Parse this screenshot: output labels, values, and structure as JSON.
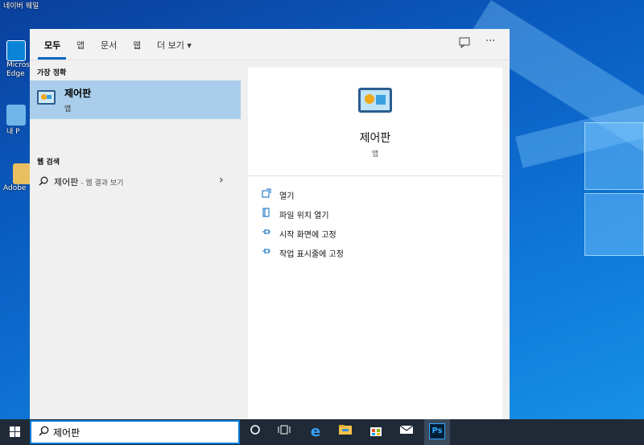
{
  "desktop": {
    "icons": [
      {
        "label": "네이버 웨일"
      },
      {
        "label": "Microsoft Edge",
        "short": "Micros Edge"
      },
      {
        "label": "내 PC",
        "short": "내 P"
      },
      {
        "label": "Adobe",
        "short": "Adobe"
      }
    ]
  },
  "start_menu": {
    "tabs": [
      "모두",
      "앱",
      "문서",
      "웹",
      "더 보기"
    ],
    "more_chevron": "▾",
    "feedback_icon": "feedback-icon",
    "options_label": "···",
    "best_match_header": "가장 정확",
    "best_match": {
      "title": "제어판",
      "subtitle": "앱"
    },
    "web_search_header": "웹 검색",
    "web_result": {
      "query": "제어판",
      "suffix": " - 웹 결과 보기"
    },
    "detail": {
      "title": "제어판",
      "subtitle": "앱",
      "actions": [
        "열기",
        "파일 위치 열기",
        "시작 화면에 고정",
        "작업 표시줄에 고정"
      ]
    }
  },
  "taskbar": {
    "search_value": "제어판",
    "search_placeholder": "",
    "apps": [
      "cortana-icon",
      "task-view-icon",
      "edge-icon",
      "file-explorer-icon",
      "store-icon",
      "mail-icon",
      "photoshop-icon"
    ],
    "ps_label": "Ps"
  },
  "colors": {
    "accent": "#0067c0",
    "selected_row": "#a9cdea",
    "taskbar": "#1f2a36"
  }
}
